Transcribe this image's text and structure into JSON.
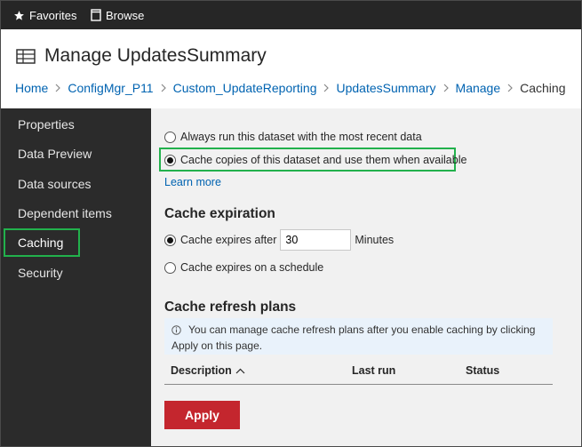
{
  "topbar": {
    "favorites_label": "Favorites",
    "browse_label": "Browse",
    "icons": {
      "favorites": "star-icon",
      "browse": "browse-icon"
    }
  },
  "header": {
    "title": "Manage UpdatesSummary",
    "icon": "dataset-table-icon"
  },
  "breadcrumb": [
    "Home",
    "ConfigMgr_P11",
    "Custom_UpdateReporting",
    "UpdatesSummary",
    "Manage",
    "Caching"
  ],
  "sidebar": {
    "items": [
      {
        "label": "Properties"
      },
      {
        "label": "Data Preview"
      },
      {
        "label": "Data sources"
      },
      {
        "label": "Dependent items"
      },
      {
        "label": "Caching"
      },
      {
        "label": "Security"
      }
    ],
    "active": "Caching"
  },
  "main": {
    "run_option_always": "Always run this dataset with the most recent data",
    "run_option_cache": "Cache copies of this dataset and use them when available",
    "selected_run_option": "cache",
    "learn_more": "Learn more",
    "expiration": {
      "heading": "Cache expiration",
      "option_after": "Cache expires after",
      "minutes_value": "30",
      "minutes_unit": "Minutes",
      "option_schedule": "Cache expires on a schedule",
      "selected": "after"
    },
    "refresh_plans": {
      "heading": "Cache refresh plans",
      "info": "You can manage cache refresh plans after you enable caching by clicking Apply on this page.",
      "columns": [
        "Description",
        "Last run",
        "Status"
      ]
    },
    "apply_label": "Apply"
  },
  "colors": {
    "topbar_bg": "#262626",
    "sidebar_bg": "#2b2b2b",
    "main_bg": "#f1f1f1",
    "link": "#0063b1",
    "highlight": "#22b14c",
    "apply": "#c4262e",
    "info_bg": "#e9f2fb"
  }
}
